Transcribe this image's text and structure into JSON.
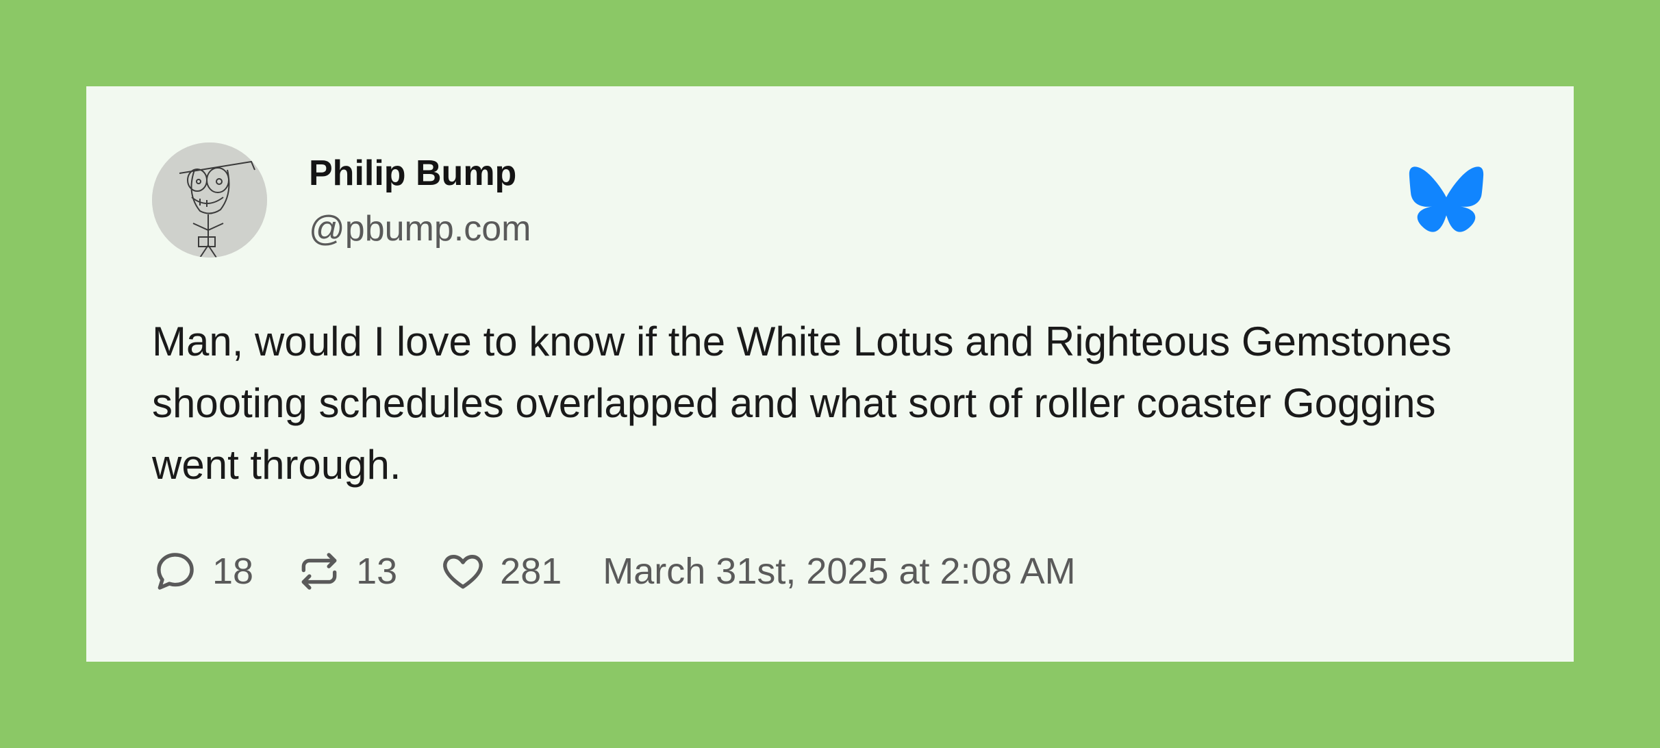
{
  "post": {
    "author": {
      "display_name": "Philip Bump",
      "handle": "@pbump.com"
    },
    "text": "Man, would I love to know if the White Lotus and Righteous Gemstones shooting schedules overlapped and what sort of roller coaster Goggins went through.",
    "stats": {
      "replies": "18",
      "reposts": "13",
      "likes": "281"
    },
    "timestamp": "March 31st, 2025 at 2:08 AM"
  },
  "icons": {
    "platform": "bluesky-butterfly-icon",
    "reply": "speech-bubble-icon",
    "repost": "repost-arrows-icon",
    "like": "heart-icon"
  },
  "colors": {
    "background": "#8bc866",
    "card": "#f2f9f0",
    "brand_blue": "#1185fe",
    "text_primary": "#1a1a1a",
    "text_secondary": "#5a5a5a"
  }
}
